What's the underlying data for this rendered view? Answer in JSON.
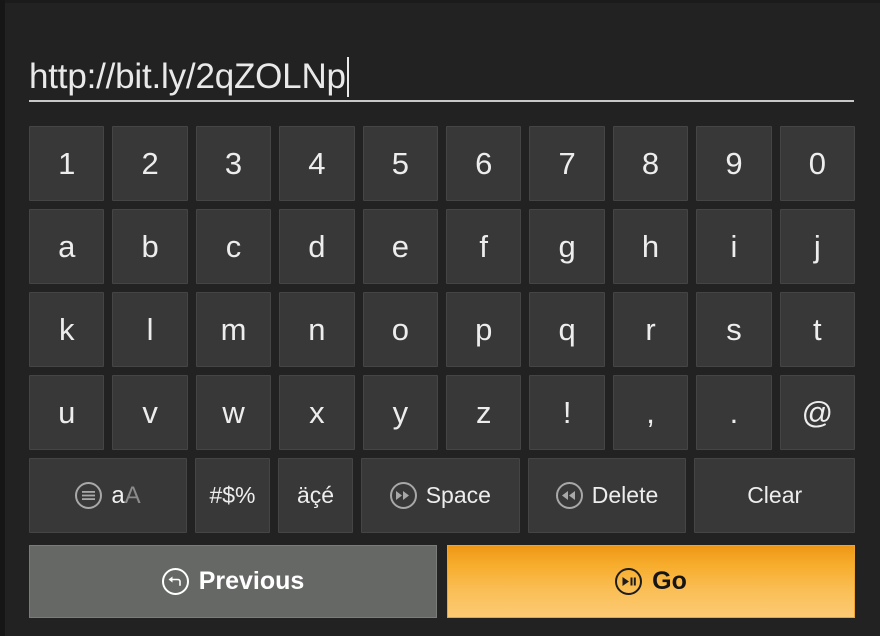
{
  "url_bar": {
    "value": "http://bit.ly/2qZOLNp",
    "caret_visible": true
  },
  "keyboard": {
    "rows": [
      [
        "1",
        "2",
        "3",
        "4",
        "5",
        "6",
        "7",
        "8",
        "9",
        "0"
      ],
      [
        "a",
        "b",
        "c",
        "d",
        "e",
        "f",
        "g",
        "h",
        "i",
        "j"
      ],
      [
        "k",
        "l",
        "m",
        "n",
        "o",
        "p",
        "q",
        "r",
        "s",
        "t"
      ],
      [
        "u",
        "v",
        "w",
        "x",
        "y",
        "z",
        "!",
        ",",
        ".",
        "@"
      ]
    ],
    "function_row": {
      "case_toggle": {
        "icon": "menu-circle-icon",
        "lower_label": "a",
        "upper_label": "A"
      },
      "symbols_label": "#$%",
      "accents_label": "äçé",
      "space": {
        "icon": "fast-forward-circle-icon",
        "label": "Space"
      },
      "delete": {
        "icon": "rewind-circle-icon",
        "label": "Delete"
      },
      "clear_label": "Clear"
    }
  },
  "actions": {
    "previous": {
      "icon": "back-arrow-circle-icon",
      "label": "Previous"
    },
    "go": {
      "icon": "play-pause-circle-icon",
      "label": "Go"
    }
  },
  "colors": {
    "background": "#222222",
    "key_face": "#383838",
    "key_text": "#ededed",
    "previous_button": "#666866",
    "go_gradient_top": "#ee9716",
    "go_gradient_bottom": "#fcca74",
    "go_text": "#151515"
  }
}
